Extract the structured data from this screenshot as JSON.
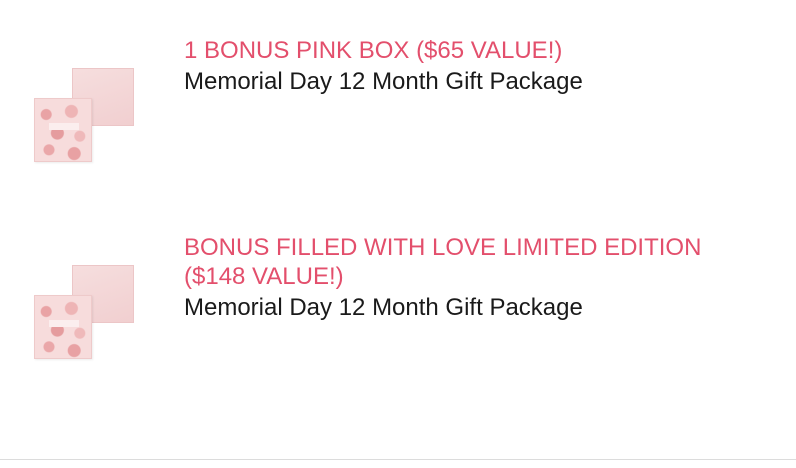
{
  "items": [
    {
      "title": "1 BONUS PINK BOX ($65 VALUE!)",
      "subtitle": "Memorial Day 12 Month Gift Package",
      "image_icon": "pink-gift-box-image"
    },
    {
      "title": "BONUS FILLED WITH LOVE LIMITED EDITION ($148 VALUE!)",
      "subtitle": "Memorial Day 12 Month Gift Package",
      "image_icon": "pink-gift-box-image"
    }
  ],
  "colors": {
    "title": "#e34f6c",
    "subtitle": "#1a1a1a",
    "box_pink": "#f1cfd0"
  }
}
